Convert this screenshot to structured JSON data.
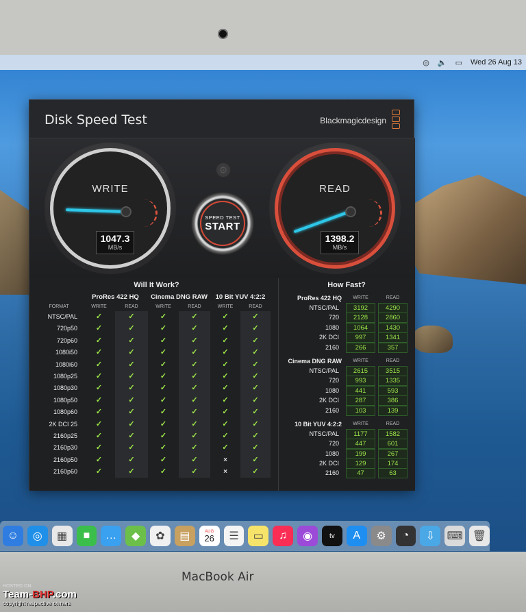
{
  "menubar": {
    "date": "Wed 26 Aug  13"
  },
  "app": {
    "title": "Disk Speed Test",
    "brand": "Blackmagicdesign",
    "write_gauge": {
      "label": "WRITE",
      "value": "1047.3",
      "unit": "MB/s"
    },
    "read_gauge": {
      "label": "READ",
      "value": "1398.2",
      "unit": "MB/s"
    },
    "start_button": {
      "small": "SPEED TEST",
      "big": "START"
    },
    "will_it_work": {
      "title": "Will It Work?",
      "groups": [
        "ProRes 422 HQ",
        "Cinema DNG RAW",
        "10 Bit YUV 4:2:2"
      ],
      "format_label": "FORMAT",
      "write_label": "WRITE",
      "read_label": "READ",
      "rows": [
        {
          "fmt": "NTSC/PAL",
          "c": [
            "✓",
            "✓",
            "✓",
            "✓",
            "✓",
            "✓"
          ]
        },
        {
          "fmt": "720p50",
          "c": [
            "✓",
            "✓",
            "✓",
            "✓",
            "✓",
            "✓"
          ]
        },
        {
          "fmt": "720p60",
          "c": [
            "✓",
            "✓",
            "✓",
            "✓",
            "✓",
            "✓"
          ]
        },
        {
          "fmt": "1080i50",
          "c": [
            "✓",
            "✓",
            "✓",
            "✓",
            "✓",
            "✓"
          ]
        },
        {
          "fmt": "1080i60",
          "c": [
            "✓",
            "✓",
            "✓",
            "✓",
            "✓",
            "✓"
          ]
        },
        {
          "fmt": "1080p25",
          "c": [
            "✓",
            "✓",
            "✓",
            "✓",
            "✓",
            "✓"
          ]
        },
        {
          "fmt": "1080p30",
          "c": [
            "✓",
            "✓",
            "✓",
            "✓",
            "✓",
            "✓"
          ]
        },
        {
          "fmt": "1080p50",
          "c": [
            "✓",
            "✓",
            "✓",
            "✓",
            "✓",
            "✓"
          ]
        },
        {
          "fmt": "1080p60",
          "c": [
            "✓",
            "✓",
            "✓",
            "✓",
            "✓",
            "✓"
          ]
        },
        {
          "fmt": "2K DCI 25",
          "c": [
            "✓",
            "✓",
            "✓",
            "✓",
            "✓",
            "✓"
          ]
        },
        {
          "fmt": "2160p25",
          "c": [
            "✓",
            "✓",
            "✓",
            "✓",
            "✓",
            "✓"
          ]
        },
        {
          "fmt": "2160p30",
          "c": [
            "✓",
            "✓",
            "✓",
            "✓",
            "✓",
            "✓"
          ]
        },
        {
          "fmt": "2160p50",
          "c": [
            "✓",
            "✓",
            "✓",
            "✓",
            "×",
            "✓"
          ]
        },
        {
          "fmt": "2160p60",
          "c": [
            "✓",
            "✓",
            "✓",
            "✓",
            "×",
            "✓"
          ]
        }
      ]
    },
    "how_fast": {
      "title": "How Fast?",
      "write_label": "WRITE",
      "read_label": "READ",
      "groups": [
        {
          "name": "ProRes 422 HQ",
          "rows": [
            {
              "fmt": "NTSC/PAL",
              "w": "3192",
              "r": "4290"
            },
            {
              "fmt": "720",
              "w": "2128",
              "r": "2860"
            },
            {
              "fmt": "1080",
              "w": "1064",
              "r": "1430"
            },
            {
              "fmt": "2K DCI",
              "w": "997",
              "r": "1341"
            },
            {
              "fmt": "2160",
              "w": "266",
              "r": "357"
            }
          ]
        },
        {
          "name": "Cinema DNG RAW",
          "rows": [
            {
              "fmt": "NTSC/PAL",
              "w": "2615",
              "r": "3515"
            },
            {
              "fmt": "720",
              "w": "993",
              "r": "1335"
            },
            {
              "fmt": "1080",
              "w": "441",
              "r": "593"
            },
            {
              "fmt": "2K DCI",
              "w": "287",
              "r": "386"
            },
            {
              "fmt": "2160",
              "w": "103",
              "r": "139"
            }
          ]
        },
        {
          "name": "10 Bit YUV 4:2:2",
          "rows": [
            {
              "fmt": "NTSC/PAL",
              "w": "1177",
              "r": "1582"
            },
            {
              "fmt": "720",
              "w": "447",
              "r": "601"
            },
            {
              "fmt": "1080",
              "w": "199",
              "r": "267"
            },
            {
              "fmt": "2K DCI",
              "w": "129",
              "r": "174"
            },
            {
              "fmt": "2160",
              "w": "47",
              "r": "63"
            }
          ]
        }
      ]
    }
  },
  "dock": {
    "calendar_month": "AUG",
    "calendar_day": "26",
    "icons": [
      "finder-icon",
      "safari-icon",
      "preview-icon",
      "facetime-icon",
      "messages-icon",
      "maps-icon",
      "photos-icon",
      "contacts-icon",
      "calendar-icon",
      "reminders-icon",
      "notes-icon",
      "music-icon",
      "podcasts-icon",
      "appletv-icon",
      "appstore-icon",
      "system-preferences-icon",
      "disk-speed-test-icon",
      "downloads-icon",
      "keyboard-icon",
      "trash-icon"
    ]
  },
  "laptop_label": "MacBook Air",
  "watermark": {
    "hosted": "HOSTED ON:",
    "site_a": "Team-",
    "site_b": "BHP",
    "site_c": ".com",
    "copy": "copyright respective owners"
  },
  "colors": {
    "accent_red": "#d94f3c",
    "needle_cyan": "#2ec7e8",
    "check_green": "#9ee84a"
  }
}
